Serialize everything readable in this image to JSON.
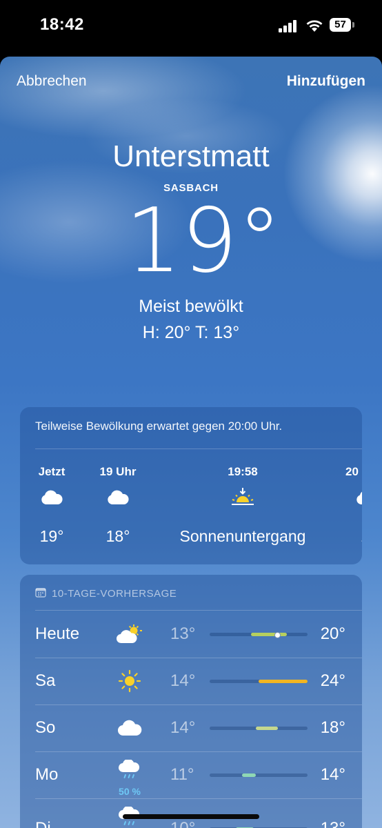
{
  "status_bar": {
    "time": "18:42",
    "battery": "57"
  },
  "sheet": {
    "cancel_label": "Abbrechen",
    "add_label": "Hinzufügen"
  },
  "location": {
    "city": "Unterstmatt",
    "district": "SASBACH"
  },
  "current": {
    "temperature": "19°",
    "condition": "Meist bewölkt",
    "high_low": "H: 20°  T: 13°"
  },
  "hourly": {
    "summary": "Teilweise Bewölkung erwartet gegen 20:00 Uhr.",
    "items": [
      {
        "label": "Jetzt",
        "icon": "cloud-icon",
        "value": "19°"
      },
      {
        "label": "19 Uhr",
        "icon": "cloud-icon",
        "value": "18°"
      },
      {
        "label": "19:58",
        "icon": "sunset-icon",
        "value": "Sonnenuntergang"
      },
      {
        "label": "20",
        "icon": "cloud-icon",
        "value": "1"
      }
    ]
  },
  "daily": {
    "header": "10-TAGE-VORHERSAGE",
    "days": [
      {
        "name": "Heute",
        "icon": "partly-sunny-icon",
        "low": "13°",
        "high": "20°",
        "bar_start": 0.42,
        "bar_end": 0.79,
        "bar_color": "#b6cf5e",
        "now_marker": 0.69
      },
      {
        "name": "Sa",
        "icon": "sun-icon",
        "low": "14°",
        "high": "24°",
        "bar_start": 0.5,
        "bar_end": 1.0,
        "bar_color": "#f2b521"
      },
      {
        "name": "So",
        "icon": "cloud-icon",
        "low": "14°",
        "high": "18°",
        "bar_start": 0.47,
        "bar_end": 0.7,
        "bar_color": "#c5d88e"
      },
      {
        "name": "Mo",
        "icon": "rain-cloud-icon",
        "low": "11°",
        "high": "14°",
        "precipitation": "50 %",
        "bar_start": 0.33,
        "bar_end": 0.47,
        "bar_color": "#8fd8b4"
      },
      {
        "name": "Di",
        "icon": "rain-cloud-icon",
        "low": "10°",
        "high": "13°",
        "bar_start": 0.27,
        "bar_end": 0.45,
        "bar_color": "#8fd8b4"
      }
    ]
  },
  "colors": {
    "sky_top": "#3d74b6",
    "sky_bottom": "#8fb3e0",
    "rain_prob": "#6ec8f5",
    "sun": "#f9d12a"
  }
}
